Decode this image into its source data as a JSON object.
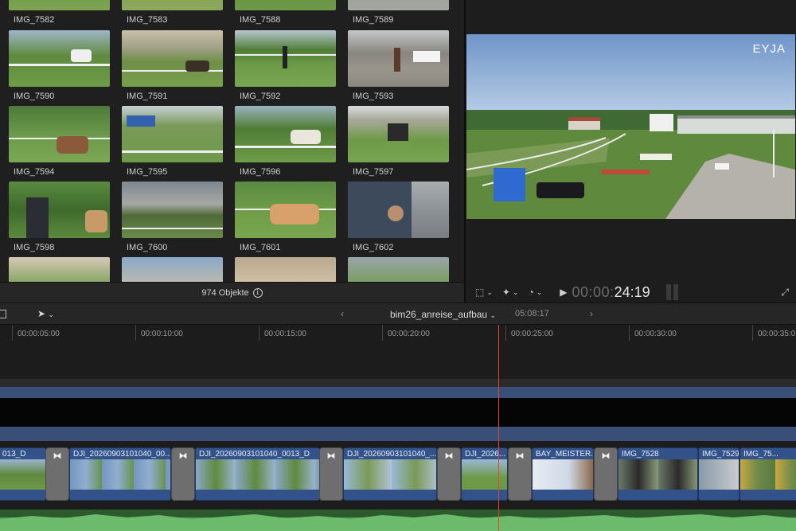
{
  "browser": {
    "clips": [
      {
        "label": "IMG_7582"
      },
      {
        "label": "IMG_7583"
      },
      {
        "label": "IMG_7588"
      },
      {
        "label": "IMG_7589"
      },
      {
        "label": "IMG_7590"
      },
      {
        "label": "IMG_7591"
      },
      {
        "label": "IMG_7592"
      },
      {
        "label": "IMG_7593"
      },
      {
        "label": "IMG_7594"
      },
      {
        "label": "IMG_7595"
      },
      {
        "label": "IMG_7596"
      },
      {
        "label": "IMG_7597"
      },
      {
        "label": "IMG_7598"
      },
      {
        "label": "IMG_7600"
      },
      {
        "label": "IMG_7601"
      },
      {
        "label": "IMG_7602"
      }
    ],
    "footer": "974 Objekte",
    "info_icon": "info-icon"
  },
  "viewer": {
    "logo": "EYJA",
    "timecode_dim": "00:00:",
    "timecode": "24:19"
  },
  "timeline": {
    "project": "bim26_anreise_aufbau",
    "duration": "05:08:17",
    "ruler": [
      "00:00:05:00",
      "00:00:10:00",
      "00:00:15:00",
      "00:00:20:00",
      "00:00:25:00",
      "00:00:30:00",
      "00:00:35:0"
    ],
    "clips": [
      {
        "name": "013_D"
      },
      {
        "name": "DJI_20260903101040_00..."
      },
      {
        "name": "DJI_20260903101040_0013_D"
      },
      {
        "name": "DJI_20260903101040_..."
      },
      {
        "name": "DJI_2026..."
      },
      {
        "name": "BAY_MEISTER..."
      },
      {
        "name": "IMG_7528"
      },
      {
        "name": "IMG_7529"
      },
      {
        "name": "IMG_75..."
      }
    ]
  },
  "colors": {
    "accent": "#d94b2a",
    "clip_blue": "#34528a",
    "audio_green": "#2d5a2d"
  }
}
